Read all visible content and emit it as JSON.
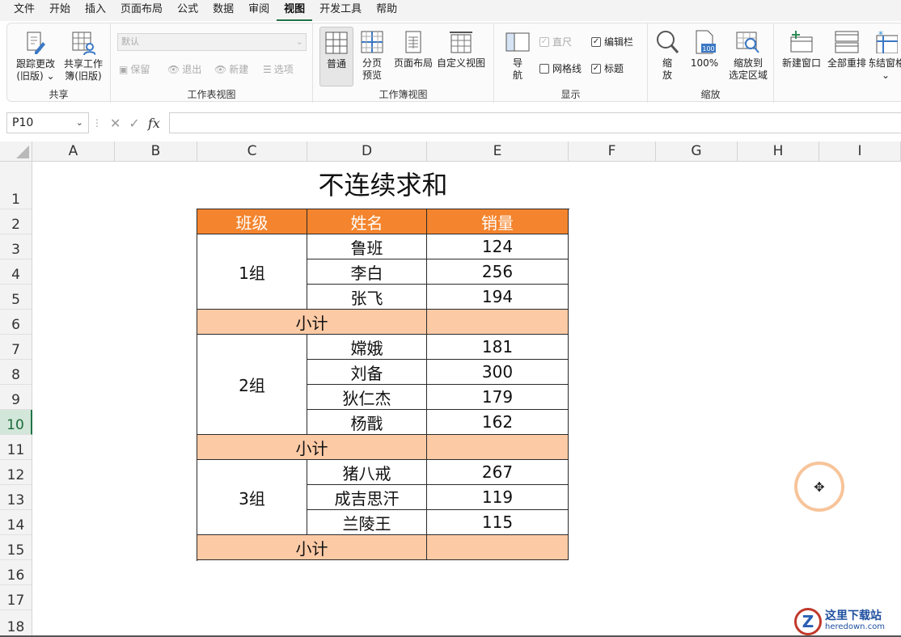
{
  "menu": [
    "文件",
    "开始",
    "插入",
    "页面布局",
    "公式",
    "数据",
    "审阅",
    "视图",
    "开发工具",
    "帮助"
  ],
  "active_menu_index": 7,
  "ribbon": {
    "share": {
      "label": "共享",
      "track_changes": "跟踪更改\n(旧版) ⌄",
      "share_workbook": "共享工作\n簿(旧版)"
    },
    "sheet_view": {
      "label": "工作表视图",
      "combo_value": "默认",
      "keep": "保留",
      "exit": "退出",
      "new": "新建",
      "options": "选项"
    },
    "workbook_views": {
      "label": "工作簿视图",
      "normal": "普通",
      "page_break": "分页\n预览",
      "page_layout": "页面布局",
      "custom_view": "自定义视图"
    },
    "show": {
      "label": "显示",
      "navigation": "导\n航",
      "ruler": "直尺",
      "gridlines": "网格线",
      "formula_bar": "编辑栏",
      "headings": "标题",
      "ruler_checked": true,
      "gridlines_checked": false,
      "formula_bar_checked": true,
      "headings_checked": true
    },
    "zoom": {
      "label": "缩放",
      "zoom": "缩\n放",
      "hundred": "100%",
      "to_selection": "缩放到\n选定区域"
    },
    "window": {
      "new_window": "新建窗口",
      "arrange_all": "全部重排",
      "freeze_panes": "冻结窗格\n⌄"
    }
  },
  "formula_bar": {
    "name_box": "P10",
    "formula": ""
  },
  "columns": [
    "A",
    "B",
    "C",
    "D",
    "E",
    "F",
    "G",
    "H",
    "I"
  ],
  "rows": [
    "1",
    "2",
    "3",
    "4",
    "5",
    "6",
    "7",
    "8",
    "9",
    "10",
    "11",
    "12",
    "13",
    "14",
    "15",
    "16",
    "17",
    "18"
  ],
  "active_row": "10",
  "sheet": {
    "title": "不连续求和",
    "headers": [
      "班级",
      "姓名",
      "销量"
    ],
    "groups": [
      {
        "name": "1组",
        "members": [
          [
            "鲁班",
            "124"
          ],
          [
            "李白",
            "256"
          ],
          [
            "张飞",
            "194"
          ]
        ]
      },
      {
        "name": "2组",
        "members": [
          [
            "嫦娥",
            "181"
          ],
          [
            "刘备",
            "300"
          ],
          [
            "狄仁杰",
            "179"
          ],
          [
            "杨戬",
            "162"
          ]
        ]
      },
      {
        "name": "3组",
        "members": [
          [
            "猪八戒",
            "267"
          ],
          [
            "成吉思汗",
            "119"
          ],
          [
            "兰陵王",
            "115"
          ]
        ]
      }
    ],
    "subtotal_label": "小计",
    "subtotal_values": [
      "",
      "",
      ""
    ]
  },
  "watermark": {
    "logo": "Z",
    "cn": "这里下载站",
    "en": "heredown.com"
  },
  "colors": {
    "header_fill": "#f4852e",
    "subtotal_fill": "#fccaa5",
    "accent": "#217346"
  }
}
